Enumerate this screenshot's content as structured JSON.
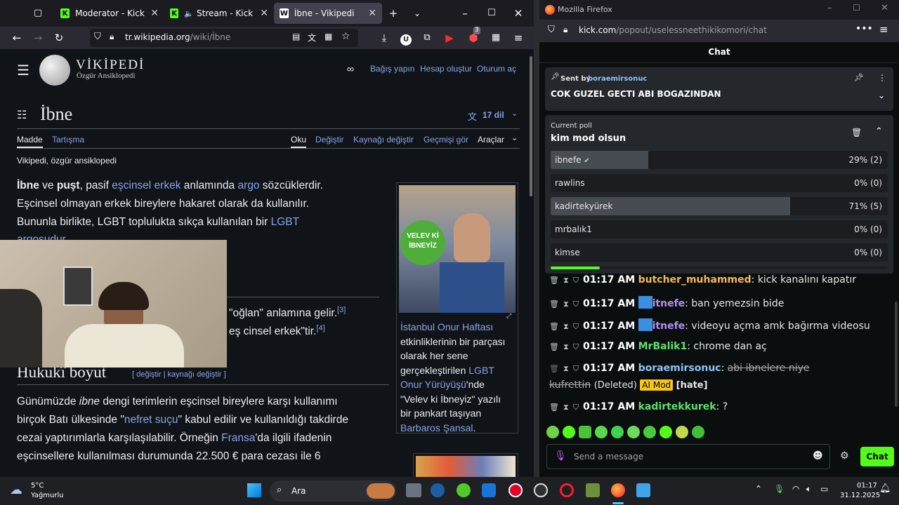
{
  "left_browser": {
    "tabs": [
      {
        "title": "Moderator - Kick Dashbo"
      },
      {
        "title": "Stream - Kick Dashbo"
      },
      {
        "title": "İbne - Vikipedi",
        "favicon": "W"
      }
    ],
    "url_host": "tr.wikipedia.org",
    "url_path": "/wiki/İbne",
    "addon_badge": "3"
  },
  "wiki": {
    "logo_title": "VİKİPEDİ",
    "logo_subtitle": "Özgür Ansiklopedi",
    "header_links": [
      "Bağış yapın",
      "Hesap oluştur",
      "Oturum aç"
    ],
    "page_title": "İbne",
    "lang_count": "17 dil",
    "tab_article": "Madde",
    "tab_talk": "Tartışma",
    "tab_read": "Oku",
    "tab_edit": "Değiştir",
    "tab_edit_source": "Kaynağı değiştir",
    "tab_history": "Geçmişi gör",
    "tab_tools": "Araçlar",
    "tagline": "Vikipedi, özgür ansiklopedi",
    "p1_b1": "İbne",
    "p1_t1": " ve ",
    "p1_b2": "puşt",
    "p1_t2": ", pasif ",
    "p1_l1": "eşcinsel erkek",
    "p1_t3": " anlamında ",
    "p1_l2": "argo",
    "p1_t4": " sözcüklerdir.",
    "p1_line2": "Eşcinsel olmayan erkek bireylere hakaret olarak da kullanılır.",
    "p1_line3a": "Bununla birlikte, LGBT topluluktа sıkça kullanılan bir ",
    "p1_l3": "LGBT",
    "p1_line4": "argosudur.",
    "p2a": "\"oğlan\" anlamına gelir.",
    "p2a_ref": "[3]",
    "p2b": "eş cinsel erkek\"tir.",
    "p2b_ref": "[4]",
    "section_title": "Hukukî boyut",
    "section_edit": "[ değiştir | kaynağı değiştir ]",
    "s_line1a": "Günümüzde ",
    "s_line1i": "ibne",
    "s_line1b": " dengi terimlerin eşcinsel bireylere karşı kullanımı",
    "s_line2a": "birçok Batı ülkesinde \"",
    "s_line2l": "nefret suçu",
    "s_line2b": "\" kabul edilir ve kullanıldığı takdirde",
    "s_line3a": "cezai yaptırımlarla karşılaşılabilir. Örneğin ",
    "s_line3l": "Fransa",
    "s_line3b": "'da ilgili ifadenin",
    "s_line4": "eşcinsellere kullanılması durumunda 22.500 € para cezası ile 6",
    "fig_sign": "VELEV Kİ İBNEYİZ",
    "caption_l1": "İstanbul Onur Haftası",
    "caption_t1": "etkinliklerinin bir parçası olarak her sene gerçekleştirilen ",
    "caption_l2": "LGBT Onur Yürüyüşü",
    "caption_t2": "'nde \"Velev ki İbneyiz\" yazılı bir pankart taşıyan ",
    "caption_l3": "Barbaros Şansal",
    "caption_t3": "."
  },
  "right_browser": {
    "window_title": "Mozilla Firefox",
    "url_host": "kick.com",
    "url_path": "/popout/uselessneethikikomori/chat",
    "chat_title": "Chat",
    "pinned_sent_by_label": "Sent by",
    "pinned_sender": "boraemirsonuc",
    "pinned_message": "COK GUZEL GECTI ABI BOGAZINDAN",
    "poll_label": "Current poll",
    "poll_question": "kim mod olsun",
    "poll_options": [
      {
        "name": "ibnefe",
        "pct": "29% (2)",
        "fraction": 0.29
      },
      {
        "name": "rawlins",
        "pct": "0% (0)",
        "fraction": 0
      },
      {
        "name": "kadirtekyürek",
        "pct": "71% (5)",
        "fraction": 0.71
      },
      {
        "name": "mrbalık1",
        "pct": "0% (0)",
        "fraction": 0
      },
      {
        "name": "kimse",
        "pct": "0% (0)",
        "fraction": 0
      }
    ],
    "messages": [
      {
        "time": "01:17 AM",
        "user": "butcher_muhammed",
        "text": "kick kanalını kapatır",
        "color": "#f7b955"
      },
      {
        "time": "01:17 AM",
        "user": "itnefe",
        "text": "ban yemezsin bide",
        "color": "#b48ff5"
      },
      {
        "time": "01:17 AM",
        "user": "itnefe",
        "text": "videoyu açma amk bağırma videosu",
        "color": "#b48ff5"
      },
      {
        "time": "01:17 AM",
        "user": "MrBalik1",
        "text": "chrome dan aç",
        "color": "#5ee06a"
      },
      {
        "time": "01:17 AM",
        "user": "boraemirsonuc",
        "text": "abi ibnelere niye",
        "color": "#8ec4f7"
      },
      {
        "time": "01:17 AM",
        "user": "kadirtekkurek",
        "text": "?",
        "color": "#5ee06a"
      }
    ],
    "deleted_tail": "kufrettin",
    "deleted_label": "(Deleted)",
    "ai_mod_label": "AI Mod",
    "hate_label": "[hate]",
    "input_placeholder": "Send a message",
    "chat_button": "Chat"
  },
  "taskbar": {
    "weather_temp": "5°C",
    "weather_text": "Yağmurlu",
    "search_label": "Ara",
    "time": "01:17",
    "date": "31.12.2025"
  },
  "colors": {
    "kick_green": "#53fc18",
    "wiki_link": "#88a3e8",
    "ai_mod": "#f5c518"
  }
}
